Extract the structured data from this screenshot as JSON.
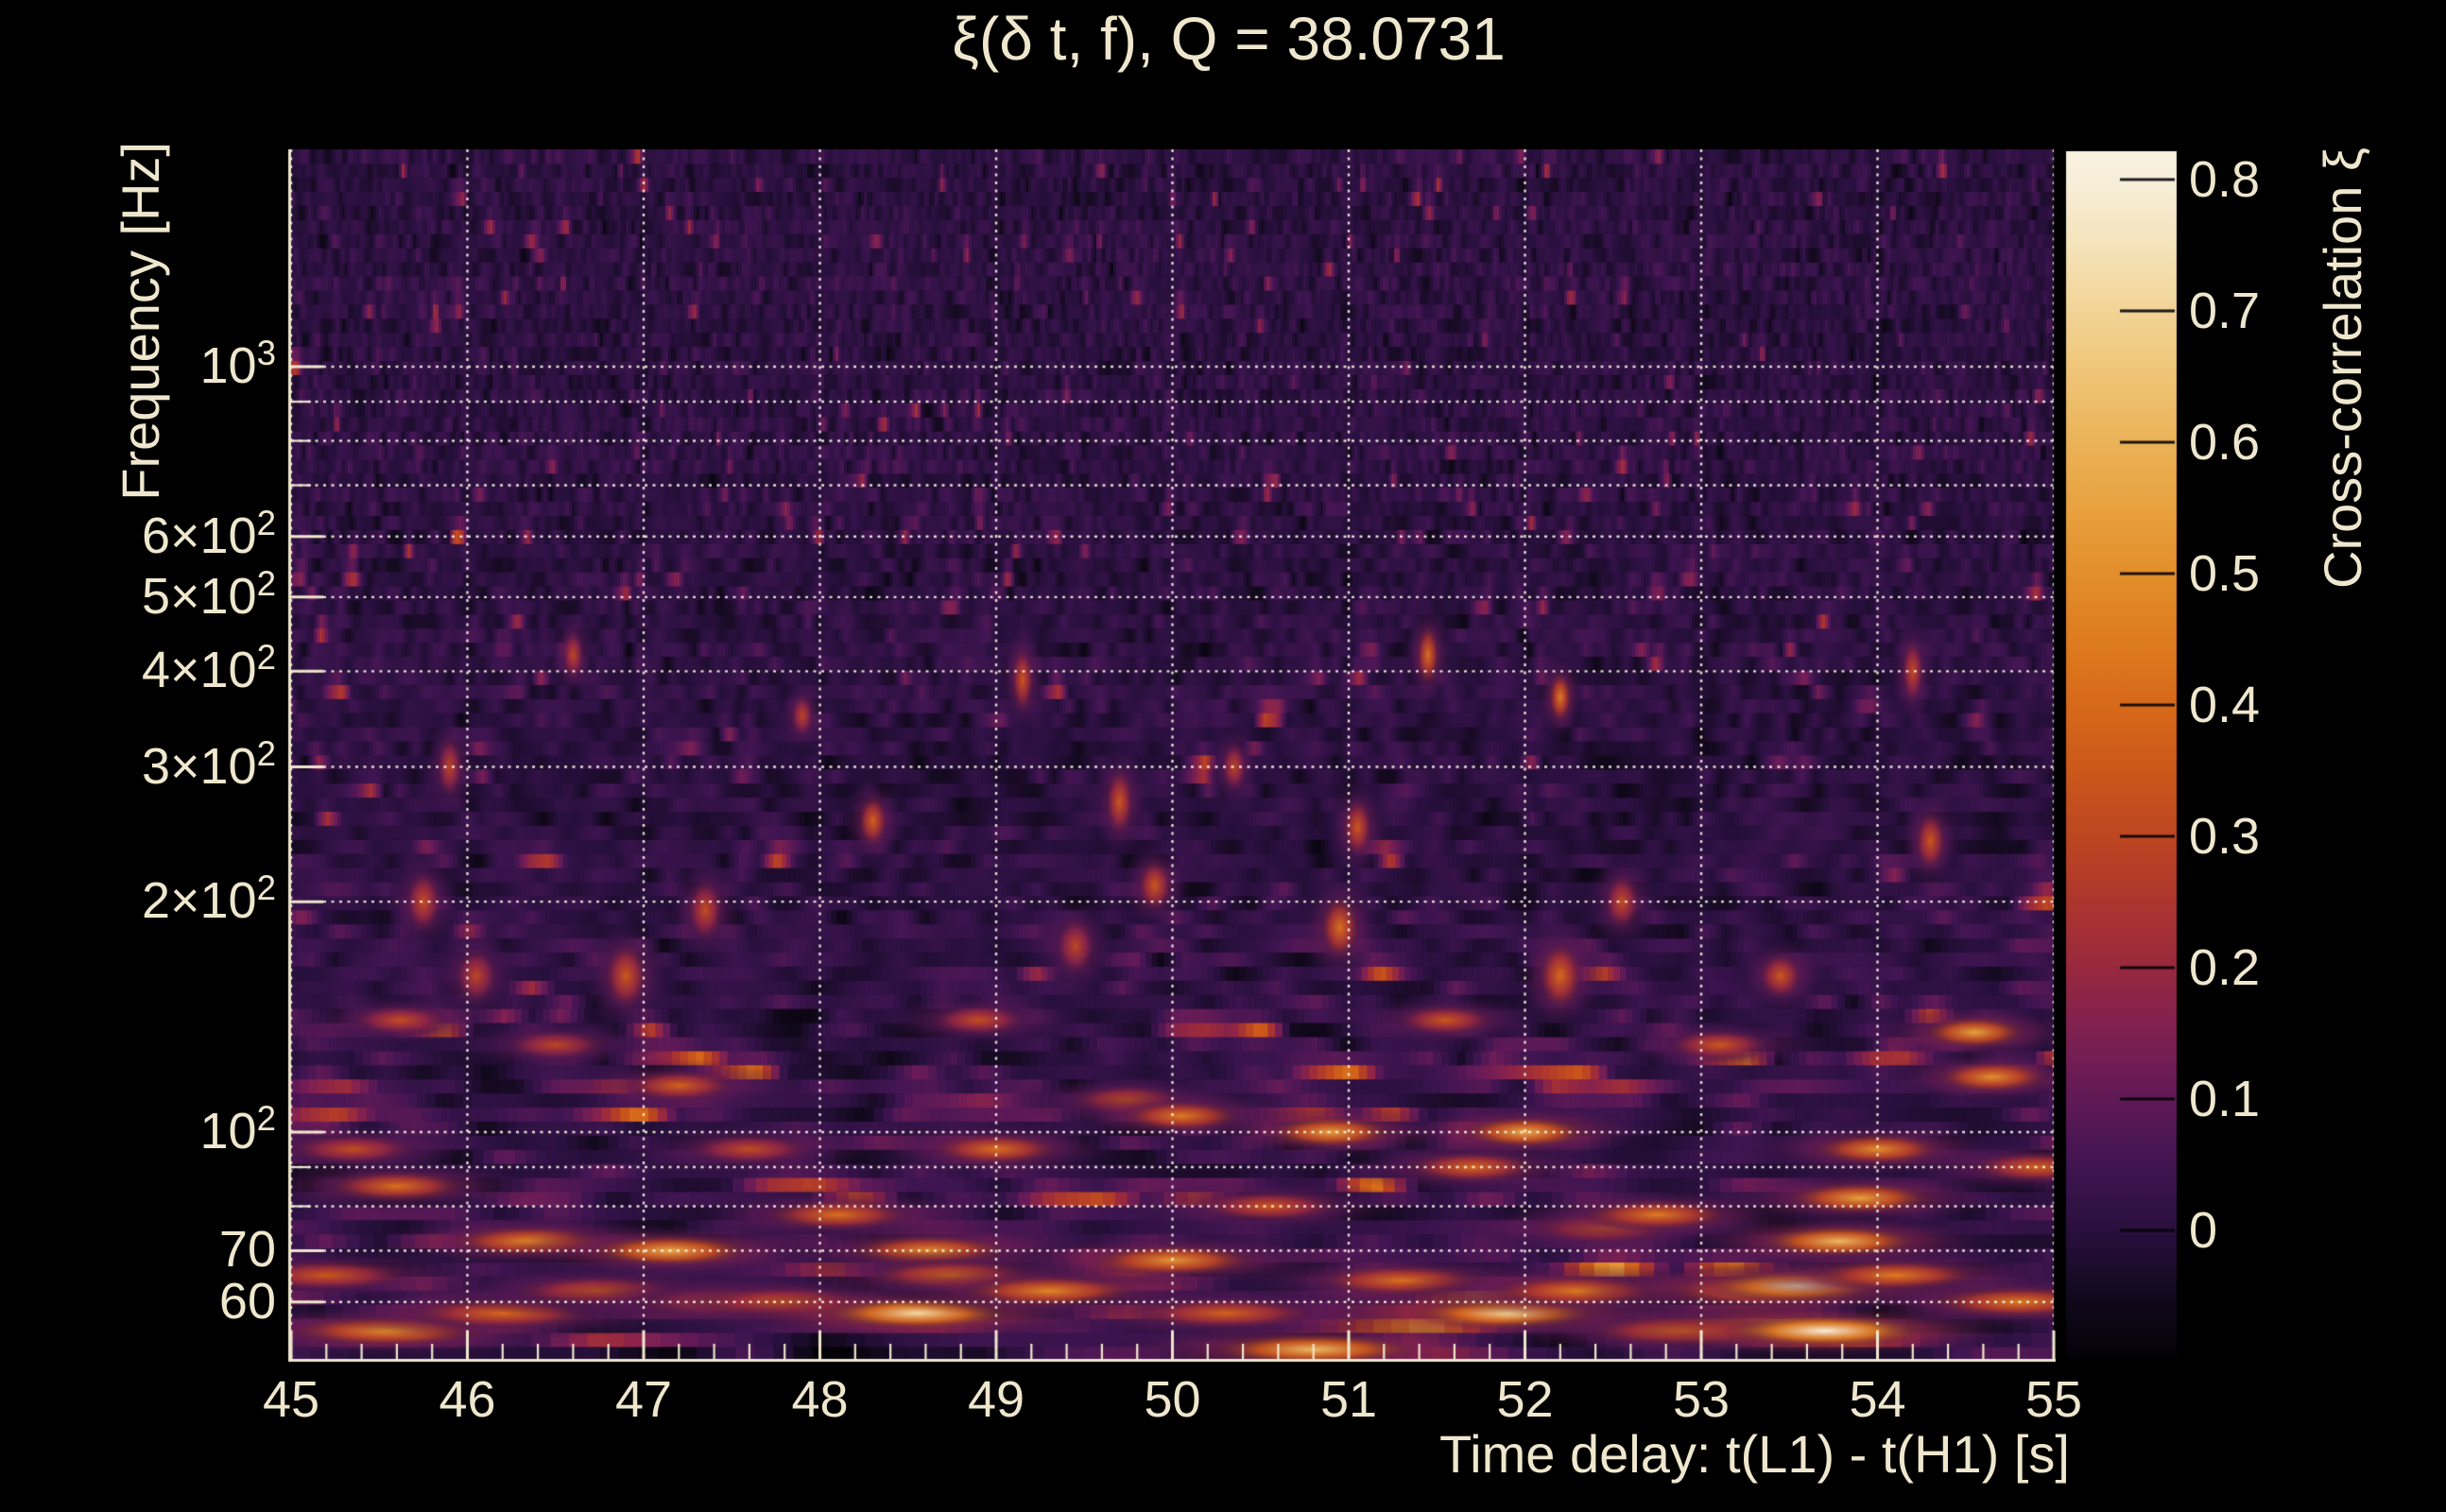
{
  "title": "ξ(δ t, f), Q = 38.0731",
  "q_value": 38.0731,
  "colors": {
    "background": "#000000",
    "text": "#efe7cd",
    "grid": "#f6f0e0",
    "axis": "#efe7cd",
    "colorbar_tick": "#060308"
  },
  "chart_data": {
    "type": "heatmap",
    "title": "ξ(δ t, f), Q = 38.0731",
    "subtitle": "",
    "x_axis": {
      "title": "Time delay: t(L1) - t(H1) [s]",
      "min": 45,
      "max": 55,
      "minor_tick_step": 0.2,
      "grid": true,
      "ticks": [
        {
          "t": 45,
          "label": "45"
        },
        {
          "t": 46,
          "label": "46"
        },
        {
          "t": 47,
          "label": "47"
        },
        {
          "t": 48,
          "label": "48"
        },
        {
          "t": 49,
          "label": "49"
        },
        {
          "t": 50,
          "label": "50"
        },
        {
          "t": 51,
          "label": "51"
        },
        {
          "t": 52,
          "label": "52"
        },
        {
          "t": 53,
          "label": "53"
        },
        {
          "t": 54,
          "label": "54"
        },
        {
          "t": 55,
          "label": "55"
        }
      ]
    },
    "y_axis": {
      "title": "Frequency [Hz]",
      "scale": "log",
      "min": 50.3,
      "max": 1924,
      "grid": true,
      "ticks": [
        {
          "f": 1000,
          "label": "10^3"
        },
        {
          "f": 600,
          "label": "6×10^2"
        },
        {
          "f": 500,
          "label": "5×10^2"
        },
        {
          "f": 400,
          "label": "4×10^2"
        },
        {
          "f": 300,
          "label": "3×10^2"
        },
        {
          "f": 200,
          "label": "2×10^2"
        },
        {
          "f": 100,
          "label": "10^2"
        },
        {
          "f": 70,
          "label": "70"
        },
        {
          "f": 60,
          "label": "60"
        }
      ],
      "minor_tick_frequencies": [
        900,
        800,
        700,
        90,
        80
      ],
      "gridline_frequencies": [
        60,
        70,
        80,
        90,
        100,
        200,
        300,
        400,
        500,
        600,
        700,
        800,
        900,
        1000
      ]
    },
    "colorbar": {
      "title": "Cross-correlation ξ",
      "value_range": [
        -0.097,
        0.822
      ],
      "ticks": [
        {
          "v": 0.0,
          "label": "0"
        },
        {
          "v": 0.1,
          "label": "0.1"
        },
        {
          "v": 0.2,
          "label": "0.2"
        },
        {
          "v": 0.3,
          "label": "0.3"
        },
        {
          "v": 0.4,
          "label": "0.4"
        },
        {
          "v": 0.5,
          "label": "0.5"
        },
        {
          "v": 0.6,
          "label": "0.6"
        },
        {
          "v": 0.7,
          "label": "0.7"
        },
        {
          "v": 0.8,
          "label": "0.8"
        }
      ],
      "colormap_anchors": [
        {
          "v": -0.105,
          "color": "#020106"
        },
        {
          "v": -0.05,
          "color": "#12091c"
        },
        {
          "v": 0.0,
          "color": "#29103e"
        },
        {
          "v": 0.05,
          "color": "#401551"
        },
        {
          "v": 0.1,
          "color": "#611a57"
        },
        {
          "v": 0.15,
          "color": "#7e2052"
        },
        {
          "v": 0.2,
          "color": "#98293e"
        },
        {
          "v": 0.25,
          "color": "#ac362e"
        },
        {
          "v": 0.3,
          "color": "#bd4622"
        },
        {
          "v": 0.35,
          "color": "#cc581a"
        },
        {
          "v": 0.4,
          "color": "#d7691a"
        },
        {
          "v": 0.45,
          "color": "#de7c1f"
        },
        {
          "v": 0.5,
          "color": "#e38f2b"
        },
        {
          "v": 0.55,
          "color": "#e8a13e"
        },
        {
          "v": 0.6,
          "color": "#ebb358"
        },
        {
          "v": 0.65,
          "color": "#efc475"
        },
        {
          "v": 0.7,
          "color": "#f2d496"
        },
        {
          "v": 0.75,
          "color": "#f5e3ba"
        },
        {
          "v": 0.8,
          "color": "#f7efdb"
        },
        {
          "v": 0.88,
          "color": "#f9f5e9"
        }
      ]
    },
    "background_noise": {
      "seed": 1337,
      "description": "Dense Q-transform cross-correlation speckle: fine vertical purple streaks above ~600 Hz, small vertically-elongated orange specks 200-600 Hz, broad horizontal orange/yellow smears below ~150 Hz; activity and brightness increase toward low frequency.",
      "typical_background_value_range": [
        -0.06,
        0.15
      ]
    },
    "hotspots": [
      [
        45.2,
        65,
        0.35
      ],
      [
        45.35,
        95,
        0.32
      ],
      [
        45.55,
        55,
        0.5
      ],
      [
        45.6,
        85,
        0.42
      ],
      [
        45.62,
        140,
        0.32
      ],
      [
        45.75,
        200,
        0.32
      ],
      [
        45.9,
        300,
        0.3
      ],
      [
        46.05,
        160,
        0.3
      ],
      [
        46.2,
        58,
        0.4
      ],
      [
        46.35,
        72,
        0.48
      ],
      [
        46.5,
        130,
        0.3
      ],
      [
        46.6,
        420,
        0.3
      ],
      [
        46.75,
        62,
        0.35
      ],
      [
        46.9,
        160,
        0.35
      ],
      [
        47.15,
        70,
        0.58
      ],
      [
        47.2,
        115,
        0.38
      ],
      [
        47.35,
        195,
        0.32
      ],
      [
        47.45,
        60,
        0.38
      ],
      [
        47.6,
        95,
        0.32
      ],
      [
        47.8,
        60,
        0.35
      ],
      [
        47.9,
        350,
        0.3
      ],
      [
        48.1,
        78,
        0.42
      ],
      [
        48.3,
        255,
        0.38
      ],
      [
        48.55,
        58,
        0.72
      ],
      [
        48.62,
        70,
        0.5
      ],
      [
        48.75,
        65,
        0.4
      ],
      [
        48.9,
        140,
        0.32
      ],
      [
        49.0,
        95,
        0.42
      ],
      [
        49.15,
        390,
        0.35
      ],
      [
        49.3,
        62,
        0.48
      ],
      [
        49.45,
        175,
        0.3
      ],
      [
        49.7,
        270,
        0.35
      ],
      [
        49.75,
        110,
        0.35
      ],
      [
        49.9,
        210,
        0.35
      ],
      [
        50.0,
        68,
        0.52
      ],
      [
        50.05,
        105,
        0.45
      ],
      [
        50.3,
        58,
        0.38
      ],
      [
        50.35,
        300,
        0.3
      ],
      [
        50.55,
        80,
        0.35
      ],
      [
        50.8,
        52,
        0.62
      ],
      [
        50.9,
        100,
        0.55
      ],
      [
        50.95,
        185,
        0.42
      ],
      [
        51.05,
        250,
        0.35
      ],
      [
        51.3,
        64,
        0.42
      ],
      [
        51.45,
        420,
        0.42
      ],
      [
        51.55,
        140,
        0.35
      ],
      [
        51.7,
        90,
        0.4
      ],
      [
        51.9,
        58,
        0.7
      ],
      [
        52.0,
        100,
        0.58
      ],
      [
        52.2,
        370,
        0.45
      ],
      [
        52.2,
        160,
        0.4
      ],
      [
        52.3,
        62,
        0.45
      ],
      [
        52.45,
        75,
        0.35
      ],
      [
        52.55,
        200,
        0.32
      ],
      [
        52.75,
        78,
        0.45
      ],
      [
        52.9,
        55,
        0.4
      ],
      [
        53.1,
        130,
        0.35
      ],
      [
        53.3,
        62,
        0.5
      ],
      [
        53.45,
        160,
        0.35
      ],
      [
        53.55,
        63,
        0.74
      ],
      [
        53.7,
        55,
        0.8
      ],
      [
        53.78,
        72,
        0.62
      ],
      [
        53.9,
        82,
        0.55
      ],
      [
        54.0,
        95,
        0.5
      ],
      [
        54.1,
        65,
        0.45
      ],
      [
        54.2,
        400,
        0.32
      ],
      [
        54.3,
        240,
        0.35
      ],
      [
        54.55,
        135,
        0.55
      ],
      [
        54.65,
        118,
        0.5
      ],
      [
        54.8,
        60,
        0.45
      ],
      [
        54.9,
        90,
        0.38
      ]
    ]
  }
}
